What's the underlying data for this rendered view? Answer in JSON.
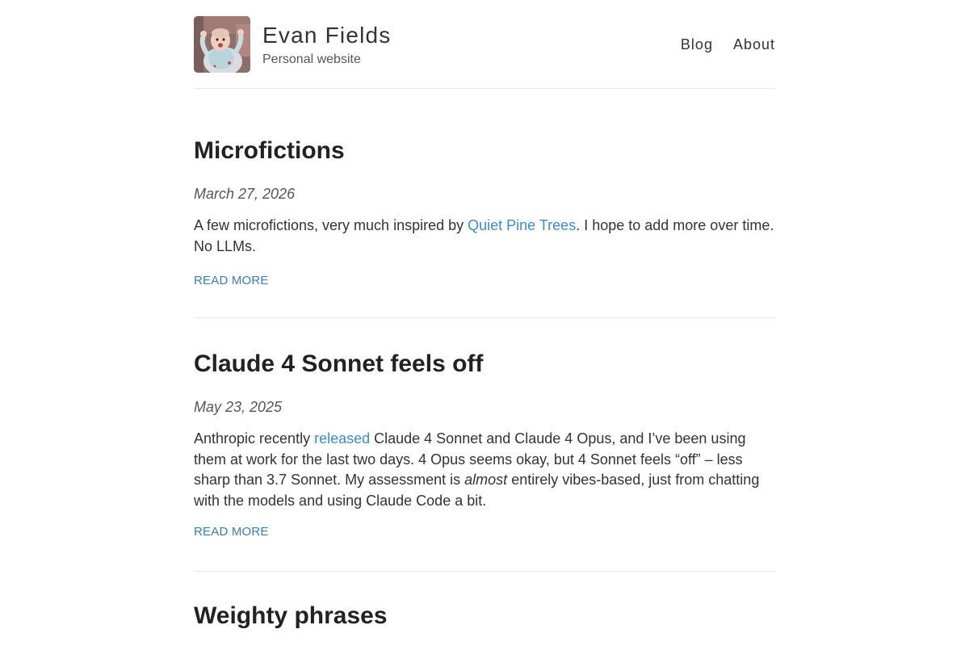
{
  "site": {
    "title": "Evan Fields",
    "subtitle": "Personal website"
  },
  "nav": {
    "items": [
      {
        "label": "Blog"
      },
      {
        "label": "About"
      }
    ]
  },
  "posts": [
    {
      "title": "Microfictions",
      "date": "March 27, 2026",
      "excerpt": {
        "before": "A few microfictions, very much inspired by ",
        "link": "Quiet Pine Trees",
        "after": ". I hope to add more over time. No LLMs."
      },
      "read_more": "READ MORE"
    },
    {
      "title": "Claude 4 Sonnet feels off",
      "date": "May 23, 2025",
      "excerpt": {
        "before": "Anthropic recently ",
        "link": "released",
        "middle": " Claude 4 Sonnet and Claude 4 Opus, and I’ve been using them at work for the last two days. 4 Opus seems okay, but 4 Sonnet feels “off” – less sharp than 3.7 Sonnet. My assessment is ",
        "emphasis": "almost",
        "after": " entirely vibes-based, just from chatting with the models and using Claude Code a bit."
      },
      "read_more": "READ MORE"
    },
    {
      "title": "Weighty phrases"
    }
  ],
  "colors": {
    "link": "#3e8bc6",
    "read_more": "#3b7db0",
    "heading": "#222222",
    "text": "#333333",
    "divider": "#e8e8e8"
  },
  "icons": {
    "avatar": "baby-photo-avatar"
  }
}
